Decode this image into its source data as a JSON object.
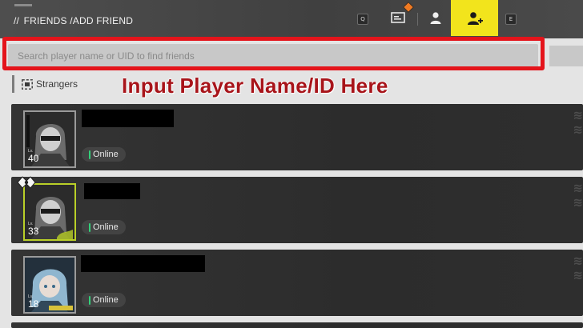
{
  "header": {
    "breadcrumb_root": "FRIENDS",
    "breadcrumb_current": "/ADD FRIEND",
    "key_left": "Q",
    "key_right": "E"
  },
  "search": {
    "placeholder": "Search player name or UID to find friends",
    "value": ""
  },
  "tabs": {
    "strangers": "Strangers"
  },
  "annotation": "Input Player Name/ID Here",
  "friends": [
    {
      "level": "40",
      "level_caption": "Lv.",
      "status": "Online"
    },
    {
      "level": "33",
      "level_caption": "Lv.",
      "status": "Online"
    },
    {
      "level": "18",
      "level_caption": "Lv.",
      "status": "Online"
    }
  ],
  "colors": {
    "accent_yellow": "#f2e41c",
    "highlight_red": "#e4141b",
    "annotation_red": "#a8141a",
    "online_green": "#33d07a",
    "notification_orange": "#f07a22"
  },
  "icons": [
    "message-icon",
    "profile-icon",
    "add-friend-icon",
    "stranger-icon"
  ]
}
